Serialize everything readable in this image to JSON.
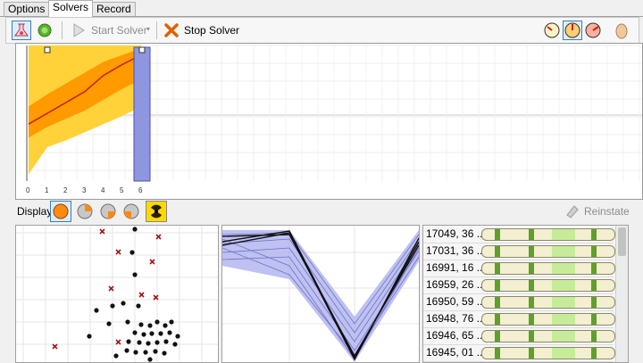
{
  "tabs": [
    "Options",
    "Solvers",
    "Record"
  ],
  "toolbar": {
    "start_label": "Start Solver",
    "stop_label": "Stop Solver"
  },
  "chart_data": {
    "type": "area",
    "x_ticks": [
      "0",
      "1",
      "2",
      "3",
      "4",
      "5",
      "6"
    ],
    "x": [
      0,
      1,
      2,
      3,
      4,
      5,
      6
    ],
    "median": [
      0.42,
      0.5,
      0.58,
      0.66,
      0.78,
      0.86,
      0.93
    ],
    "inner_band_low": [
      0.32,
      0.4,
      0.46,
      0.52,
      0.6,
      0.68,
      0.75
    ],
    "inner_band_high": [
      0.55,
      0.64,
      0.72,
      0.8,
      0.88,
      0.93,
      0.98
    ],
    "outer_band_low": [
      0.05,
      0.25,
      0.3,
      0.36,
      0.42,
      0.48,
      0.55
    ],
    "outer_band_high": [
      1.0,
      1.0,
      1.0,
      1.0,
      1.0,
      1.0,
      1.0
    ],
    "colors": {
      "outer": "#ffd23a",
      "inner": "#ff9a00",
      "line": "#c02000",
      "selection": "#8f96e0"
    }
  },
  "display": {
    "label": "Display",
    "reinstate_label": "Reinstate"
  },
  "list": {
    "rows": [
      {
        "label": "17049, 36 ..."
      },
      {
        "label": "17031, 36 ..."
      },
      {
        "label": "16991, 16 ..."
      },
      {
        "label": "16959, 26 ..."
      },
      {
        "label": "16950, 59 ..."
      },
      {
        "label": "16948, 76 ..."
      },
      {
        "label": "16946, 65 ..."
      },
      {
        "label": "16945, 01 ..."
      }
    ]
  },
  "icons": {
    "solver_icon": "flask-icon",
    "gem_icon": "green-gem-icon",
    "play_icon": "play-icon",
    "stop_icon": "x-icon",
    "gauges": [
      "gauge-slow-icon",
      "gauge-medium-icon",
      "gauge-fast-icon"
    ],
    "egg": "egg-icon",
    "radiation": "radiation-icon"
  }
}
